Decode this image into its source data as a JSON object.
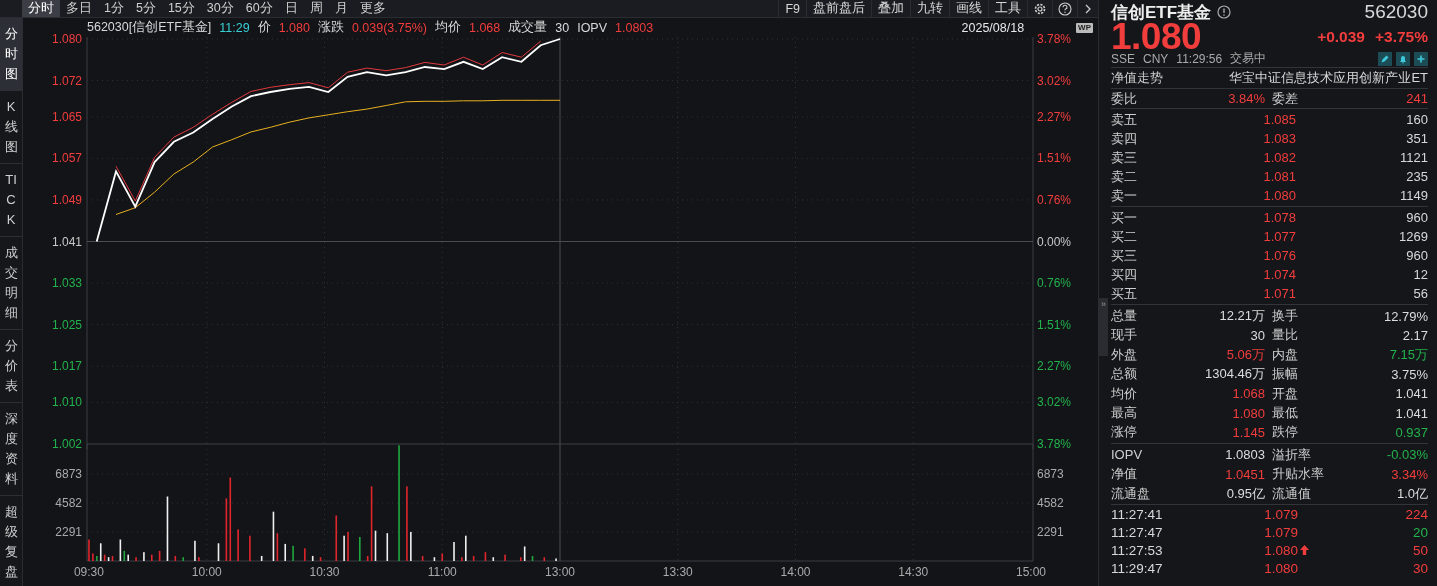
{
  "toolbar": {
    "tabs": [
      {
        "label": "分时",
        "selected": true
      },
      {
        "label": "多日",
        "selected": false
      },
      {
        "label": "1分",
        "selected": false
      },
      {
        "label": "5分",
        "selected": false
      },
      {
        "label": "15分",
        "selected": false
      },
      {
        "label": "30分",
        "selected": false
      },
      {
        "label": "60分",
        "selected": false
      },
      {
        "label": "日",
        "selected": false
      },
      {
        "label": "周",
        "selected": false
      },
      {
        "label": "月",
        "selected": false
      },
      {
        "label": "更多",
        "selected": false
      }
    ],
    "tools": [
      "F9",
      "盘前盘后",
      "叠加",
      "九转",
      "画线",
      "工具"
    ]
  },
  "sidebar": {
    "items": [
      {
        "label": "分时图",
        "selected": true
      },
      {
        "label": "K线图",
        "selected": false
      },
      {
        "label": "TICK",
        "selected": false
      },
      {
        "label": "成交明细",
        "selected": false
      },
      {
        "label": "分价表",
        "selected": false
      },
      {
        "label": "深度资料",
        "selected": false
      },
      {
        "label": "超级复盘",
        "selected": false
      }
    ]
  },
  "chart": {
    "header": {
      "code_name": "562030[信创ETF基金]",
      "time": "11:29",
      "fields": [
        {
          "label": "价",
          "value": "1.080",
          "color": "#f23d3d"
        },
        {
          "label": "涨跌",
          "value": "0.039(3.75%)",
          "color": "#f23d3d"
        },
        {
          "label": "均价",
          "value": "1.068",
          "color": "#f23d3d"
        },
        {
          "label": "成交量",
          "value": "30",
          "color": "#dcdcdc"
        },
        {
          "label": "IOPV",
          "value": "1.0803",
          "color": "#f23d3d"
        }
      ],
      "date": "2025/08/18",
      "badge": "WP"
    },
    "price": {
      "chart_data": {
        "type": "line",
        "grid": true,
        "categories": [
          null,
          null,
          null,
          null,
          null,
          null,
          null,
          null,
          null,
          null,
          null,
          null,
          null,
          null,
          null,
          null,
          null,
          null,
          null,
          null,
          null,
          null,
          null,
          null,
          null,
          null,
          null,
          null,
          null,
          null,
          null,
          null,
          null,
          null,
          null,
          null,
          null,
          null,
          null,
          null,
          null,
          null,
          null,
          null,
          null,
          null,
          null,
          null,
          null
        ],
        "ylim": [
          1.002,
          1.08
        ],
        "yticks": [
          {
            "value": 1.08,
            "label": "1.080"
          },
          {
            "value": 1.072,
            "label": "1.072"
          },
          {
            "value": 1.065,
            "label": "1.065"
          },
          {
            "value": 1.057,
            "label": "1.057"
          },
          {
            "value": 1.049,
            "label": "1.049"
          },
          {
            "value": 1.041,
            "label": "1.041"
          },
          {
            "value": 1.033,
            "label": "1.033"
          },
          {
            "value": 1.025,
            "label": "1.025"
          },
          {
            "value": 1.017,
            "label": "1.017"
          },
          {
            "value": 1.01,
            "label": "1.010"
          },
          {
            "value": 1.002,
            "label": "1.002"
          }
        ],
        "series": [
          {
            "color": "#e0393e",
            "values": [
              null,
              1.0555,
              1.0488,
              1.0572,
              1.0611,
              1.063,
              1.0655,
              1.0678,
              1.0699,
              1.0707,
              1.0712,
              1.0716,
              1.0706,
              1.0736,
              1.0744,
              1.0739,
              1.0745,
              1.0755,
              1.075,
              1.0765,
              1.075,
              1.0774,
              1.0765,
              1.0796,
              null,
              null,
              null,
              null,
              null,
              null,
              null,
              null,
              null,
              null,
              null,
              null,
              null,
              null,
              null,
              null,
              null,
              null,
              null,
              null,
              null,
              null,
              null,
              null,
              null
            ]
          },
          {
            "color": "#e8b020",
            "values": [
              null,
              1.0462,
              1.0475,
              1.0505,
              1.054,
              1.0563,
              1.0592,
              1.0606,
              1.0621,
              1.063,
              1.064,
              1.0648,
              1.0654,
              1.066,
              1.0665,
              1.0672,
              1.0679,
              1.068,
              1.068,
              1.0681,
              1.0681,
              1.0682,
              1.0682,
              1.0682,
              1.0682,
              null,
              null,
              null,
              null,
              null,
              null,
              null,
              null,
              null,
              null,
              null,
              null,
              null,
              null,
              null,
              null,
              null,
              null,
              null,
              null,
              null,
              null,
              null,
              null
            ]
          },
          {
            "color": "#ffffff",
            "values": [
              1.041,
              1.0545,
              1.0477,
              1.0563,
              1.0602,
              1.062,
              1.0646,
              1.067,
              1.069,
              1.0698,
              1.0704,
              1.0708,
              1.0698,
              1.0727,
              1.0736,
              1.073,
              1.0736,
              1.0746,
              1.0742,
              1.0756,
              1.0742,
              1.0765,
              1.0756,
              1.0788,
              1.08,
              null,
              null,
              null,
              null,
              null,
              null,
              null,
              null,
              null,
              null,
              null,
              null,
              null,
              null,
              null,
              null,
              null,
              null,
              null,
              null,
              null,
              null,
              null,
              null
            ]
          }
        ]
      },
      "right_axis_labels": [
        "3.78%",
        "3.02%",
        "2.27%",
        "1.51%",
        "0.76%",
        "0.00%",
        "0.76%",
        "1.51%",
        "2.27%",
        "3.02%",
        "3.78%"
      ]
    },
    "volume": {
      "chart_data": {
        "type": "bar",
        "grid": true,
        "ylim": [
          0,
          9250
        ],
        "yticks": [
          {
            "value": 6873,
            "label": "6873"
          },
          {
            "value": 4582,
            "label": "4582"
          },
          {
            "value": 2291,
            "label": "2291"
          }
        ],
        "categories": [
          "09:30",
          null,
          null,
          null,
          null,
          null,
          null,
          null,
          null,
          null,
          null,
          null,
          null,
          null,
          null,
          null,
          null,
          null,
          null,
          null,
          null,
          null,
          null,
          null,
          null,
          null,
          null,
          null,
          null,
          null,
          "10:00",
          null,
          null,
          null,
          null,
          null,
          null,
          null,
          null,
          null,
          null,
          null,
          null,
          null,
          null,
          null,
          null,
          null,
          null,
          null,
          null,
          null,
          null,
          null,
          null,
          null,
          null,
          null,
          null,
          null,
          "10:30",
          null,
          null,
          null,
          null,
          null,
          null,
          null,
          null,
          null,
          null,
          null,
          null,
          null,
          null,
          null,
          null,
          null,
          null,
          null,
          null,
          null,
          null,
          null,
          null,
          null,
          null,
          null,
          null,
          null,
          "11:00",
          null,
          null,
          null,
          null,
          null,
          null,
          null,
          null,
          null,
          null,
          null,
          null,
          null,
          null,
          null,
          null,
          null,
          null,
          null,
          null,
          null,
          null,
          null,
          null,
          null,
          null,
          null,
          null,
          null,
          "13:00",
          null,
          null,
          null,
          null,
          null,
          null,
          null,
          null,
          null,
          null,
          null,
          null,
          null,
          null,
          null,
          null,
          null,
          null,
          null,
          null,
          null,
          null,
          null,
          null,
          null,
          null,
          null,
          null,
          null,
          "13:30",
          null,
          null,
          null,
          null,
          null,
          null,
          null,
          null,
          null,
          null,
          null,
          null,
          null,
          null,
          null,
          null,
          null,
          null,
          null,
          null,
          null,
          null,
          null,
          null,
          null,
          null,
          null,
          null,
          null,
          "14:00",
          null,
          null,
          null,
          null,
          null,
          null,
          null,
          null,
          null,
          null,
          null,
          null,
          null,
          null,
          null,
          null,
          null,
          null,
          null,
          null,
          null,
          null,
          null,
          null,
          null,
          null,
          null,
          null,
          null,
          "14:30",
          null,
          null,
          null,
          null,
          null,
          null,
          null,
          null,
          null,
          null,
          null,
          null,
          null,
          null,
          null,
          null,
          null,
          null,
          null,
          null,
          null,
          null,
          null,
          null,
          null,
          null,
          null,
          null,
          null,
          "15:00"
        ],
        "series": [
          {
            "color": "#e0252b",
            "values": [
              1700,
              600,
              null,
              null,
              500,
              null,
              400,
              null,
              null,
              null,
              null,
              null,
              300,
              null,
              null,
              null,
              500,
              null,
              800,
              null,
              null,
              null,
              400,
              null,
              null,
              null,
              null,
              null,
              300,
              null,
              null,
              null,
              null,
              null,
              null,
              4950,
              6600,
              null,
              2500,
              null,
              null,
              2000,
              null,
              null,
              null,
              null,
              null,
              null,
              2200,
              null,
              null,
              null,
              null,
              null,
              null,
              1000,
              null,
              null,
              null,
              300,
              null,
              null,
              null,
              3600,
              null,
              null,
              2300,
              null,
              null,
              null,
              null,
              400,
              5900,
              null,
              null,
              null,
              null,
              null,
              null,
              null,
              null,
              5900,
              null,
              null,
              null,
              400,
              null,
              null,
              null,
              null,
              600,
              null,
              null,
              null,
              null,
              300,
              null,
              null,
              400,
              null,
              null,
              700,
              null,
              null,
              null,
              null,
              500,
              null,
              null,
              null,
              300,
              null,
              null,
              null,
              null,
              null,
              300,
              null,
              null,
              null,
              null,
              null,
              null,
              null,
              null,
              null,
              null,
              null,
              null,
              null,
              null,
              null,
              null,
              null,
              null,
              null,
              null,
              null,
              null,
              null,
              null,
              null,
              null,
              null,
              null,
              null,
              null,
              null,
              null,
              null,
              null,
              null,
              null,
              null,
              null,
              null,
              null,
              null,
              null,
              null,
              null,
              null,
              null,
              null,
              null,
              null,
              null,
              null,
              null,
              null,
              null,
              null,
              null,
              null,
              null,
              null,
              null,
              null,
              null,
              null,
              null,
              null,
              null,
              null,
              null,
              null,
              null,
              null,
              null,
              null,
              null,
              null,
              null,
              null,
              null,
              null,
              null,
              null,
              null,
              null,
              null,
              null,
              null,
              null,
              null,
              null,
              null,
              null,
              null,
              null,
              null,
              null,
              null,
              null,
              null,
              null,
              null,
              null,
              null,
              null,
              null,
              null,
              null,
              null,
              null,
              null,
              null,
              null,
              null,
              null,
              null,
              null,
              null,
              null,
              null,
              null,
              null,
              null,
              null,
              null,
              null
            ]
          },
          {
            "color": "#1fa83e",
            "values": [
              null,
              null,
              400,
              null,
              null,
              null,
              null,
              null,
              null,
              800,
              null,
              null,
              null,
              null,
              null,
              null,
              null,
              null,
              null,
              null,
              null,
              null,
              null,
              null,
              300,
              null,
              null,
              null,
              null,
              null,
              null,
              null,
              null,
              null,
              null,
              null,
              null,
              null,
              null,
              null,
              null,
              null,
              null,
              null,
              null,
              null,
              null,
              null,
              null,
              null,
              null,
              null,
              1200,
              null,
              null,
              null,
              null,
              null,
              null,
              null,
              null,
              null,
              null,
              null,
              null,
              null,
              null,
              null,
              null,
              1900,
              null,
              null,
              null,
              null,
              null,
              null,
              null,
              null,
              null,
              9150,
              null,
              null,
              null,
              null,
              null,
              null,
              null,
              null,
              null,
              null,
              null,
              null,
              null,
              null,
              null,
              null,
              null,
              null,
              null,
              null,
              null,
              null,
              null,
              null,
              null,
              null,
              null,
              null,
              null,
              null,
              null,
              null,
              null,
              400,
              null,
              null,
              null,
              null,
              null,
              null,
              null,
              null,
              null,
              null,
              null,
              null,
              null,
              null,
              null,
              null,
              null,
              null,
              null,
              null,
              null,
              null,
              null,
              null,
              null,
              null,
              null,
              null,
              null,
              null,
              null,
              null,
              null,
              null,
              null,
              null,
              null,
              null,
              null,
              null,
              null,
              null,
              null,
              null,
              null,
              null,
              null,
              null,
              null,
              null,
              null,
              null,
              null,
              null,
              null,
              null,
              null,
              null,
              null,
              null,
              null,
              null,
              null,
              null,
              null,
              null,
              null,
              null,
              null,
              null,
              null,
              null,
              null,
              null,
              null,
              null,
              null,
              null,
              null,
              null,
              null,
              null,
              null,
              null,
              null,
              null,
              null,
              null,
              null,
              null,
              null,
              null,
              null,
              null,
              null,
              null,
              null,
              null,
              null,
              null,
              null,
              null,
              null,
              null,
              null,
              null,
              null,
              null,
              null,
              null,
              null,
              null,
              null,
              null,
              null,
              null,
              null,
              null,
              null,
              null,
              null,
              null,
              null,
              null,
              null,
              null,
              null
            ]
          },
          {
            "color": "#f0f0f0",
            "values": [
              null,
              null,
              null,
              1400,
              null,
              300,
              null,
              null,
              1700,
              null,
              500,
              null,
              null,
              null,
              700,
              null,
              null,
              null,
              null,
              null,
              5100,
              null,
              null,
              null,
              null,
              null,
              null,
              1600,
              null,
              null,
              null,
              null,
              null,
              1400,
              null,
              null,
              null,
              null,
              null,
              null,
              null,
              null,
              null,
              null,
              400,
              null,
              null,
              3900,
              null,
              null,
              1350,
              null,
              null,
              null,
              null,
              null,
              null,
              400,
              null,
              null,
              null,
              null,
              null,
              null,
              null,
              2000,
              null,
              null,
              null,
              null,
              null,
              null,
              null,
              2400,
              null,
              null,
              2200,
              null,
              null,
              null,
              null,
              null,
              2300,
              null,
              null,
              null,
              null,
              null,
              300,
              null,
              null,
              null,
              null,
              1500,
              null,
              null,
              2000,
              null,
              null,
              null,
              null,
              null,
              null,
              300,
              null,
              null,
              null,
              null,
              null,
              null,
              null,
              1150,
              null,
              null,
              null,
              null,
              null,
              null,
              null,
              200,
              null,
              null,
              null,
              null,
              null,
              null,
              null,
              null,
              null,
              null,
              null,
              null,
              null,
              null,
              null,
              null,
              null,
              null,
              null,
              null,
              null,
              null,
              null,
              null,
              null,
              null,
              null,
              null,
              null,
              null,
              null,
              null,
              null,
              null,
              null,
              null,
              null,
              null,
              null,
              null,
              null,
              null,
              null,
              null,
              null,
              null,
              null,
              null,
              null,
              null,
              null,
              null,
              null,
              null,
              null,
              null,
              null,
              null,
              null,
              null,
              null,
              null,
              null,
              null,
              null,
              null,
              null,
              null,
              null,
              null,
              null,
              null,
              null,
              null,
              null,
              null,
              null,
              null,
              null,
              null,
              null,
              null,
              null,
              null,
              null,
              null,
              null,
              null,
              null,
              null,
              null,
              null,
              null,
              null,
              null,
              null,
              null,
              null,
              null,
              null,
              null,
              null,
              null,
              null,
              null,
              null,
              null,
              null,
              null,
              null,
              null,
              null,
              null,
              null,
              null,
              null,
              null,
              null,
              null,
              null,
              null
            ]
          }
        ]
      },
      "right_axis_labels": [
        "6873",
        "4582",
        "2291"
      ]
    }
  },
  "quote": {
    "name": "信创ETF基金",
    "code": "562030",
    "price": "1.080",
    "change": "+0.039",
    "change_pct": "+3.75%",
    "color": "#f23d3d",
    "exchange": "SSE",
    "currency": "CNY",
    "time": "11:29:56",
    "status": "交易中",
    "nav": {
      "label": "净值走势",
      "value": "华宝中证信息技术应用创新产业ET"
    },
    "commission": [
      {
        "label": "委比",
        "value": "3.84%",
        "color": "#f23d3d"
      },
      {
        "label": "委差",
        "value": "241",
        "color": "#f23d3d"
      }
    ],
    "asks": [
      {
        "label": "卖五",
        "price": "1.085",
        "volume": "160"
      },
      {
        "label": "卖四",
        "price": "1.083",
        "volume": "351"
      },
      {
        "label": "卖三",
        "price": "1.082",
        "volume": "1121"
      },
      {
        "label": "卖二",
        "price": "1.081",
        "volume": "235"
      },
      {
        "label": "卖一",
        "price": "1.080",
        "volume": "1149"
      }
    ],
    "bids": [
      {
        "label": "买一",
        "price": "1.078",
        "volume": "960"
      },
      {
        "label": "买二",
        "price": "1.077",
        "volume": "1269"
      },
      {
        "label": "买三",
        "price": "1.076",
        "volume": "960"
      },
      {
        "label": "买四",
        "price": "1.074",
        "volume": "12"
      },
      {
        "label": "买五",
        "price": "1.071",
        "volume": "56"
      }
    ],
    "stats": [
      [
        {
          "label": "总量",
          "value": "12.21万",
          "color": "#dcdcdc"
        },
        {
          "label": "换手",
          "value": "12.79%",
          "color": "#dcdcdc"
        }
      ],
      [
        {
          "label": "现手",
          "value": "30",
          "color": "#dcdcdc"
        },
        {
          "label": "量比",
          "value": "2.17",
          "color": "#dcdcdc"
        }
      ],
      [
        {
          "label": "外盘",
          "value": "5.06万",
          "color": "#f23d3d"
        },
        {
          "label": "内盘",
          "value": "7.15万",
          "color": "#22b34c"
        }
      ],
      [
        {
          "label": "总额",
          "value": "1304.46万",
          "color": "#dcdcdc"
        },
        {
          "label": "振幅",
          "value": "3.75%",
          "color": "#dcdcdc"
        }
      ],
      [
        {
          "label": "均价",
          "value": "1.068",
          "color": "#f23d3d"
        },
        {
          "label": "开盘",
          "value": "1.041",
          "color": "#dcdcdc"
        }
      ],
      [
        {
          "label": "最高",
          "value": "1.080",
          "color": "#f23d3d"
        },
        {
          "label": "最低",
          "value": "1.041",
          "color": "#dcdcdc"
        }
      ],
      [
        {
          "label": "涨停",
          "value": "1.145",
          "color": "#f23d3d"
        },
        {
          "label": "跌停",
          "value": "0.937",
          "color": "#22b34c"
        }
      ]
    ],
    "etf_stats": [
      [
        {
          "label": "IOPV",
          "value": "1.0803",
          "color": "#dcdcdc"
        },
        {
          "label": "溢折率",
          "value": "-0.03%",
          "color": "#22b34c"
        }
      ],
      [
        {
          "label": "净值",
          "value": "1.0451",
          "color": "#f23d3d"
        },
        {
          "label": "升贴水率",
          "value": "3.34%",
          "color": "#f23d3d"
        }
      ],
      [
        {
          "label": "流通盘",
          "value": "0.95亿",
          "color": "#dcdcdc"
        },
        {
          "label": "流通值",
          "value": "1.0亿",
          "color": "#dcdcdc"
        }
      ]
    ],
    "trades": [
      {
        "time": "11:27:41",
        "price": {
          "value": "1.079",
          "color": "#f23d3d"
        },
        "volume": {
          "value": "224",
          "color": "#f23d3d"
        },
        "uptick": false
      },
      {
        "time": "11:27:47",
        "price": {
          "value": "1.079",
          "color": "#f23d3d"
        },
        "volume": {
          "value": "20",
          "color": "#22b34c"
        },
        "uptick": false
      },
      {
        "time": "11:27:53",
        "price": {
          "value": "1.080",
          "color": "#f23d3d"
        },
        "volume": {
          "value": "50",
          "color": "#f23d3d"
        },
        "uptick": true
      },
      {
        "time": "11:29:47",
        "price": {
          "value": "1.080",
          "color": "#f23d3d"
        },
        "volume": {
          "value": "30",
          "color": "#f23d3d"
        },
        "uptick": false
      }
    ],
    "collapse_handle": "»"
  }
}
